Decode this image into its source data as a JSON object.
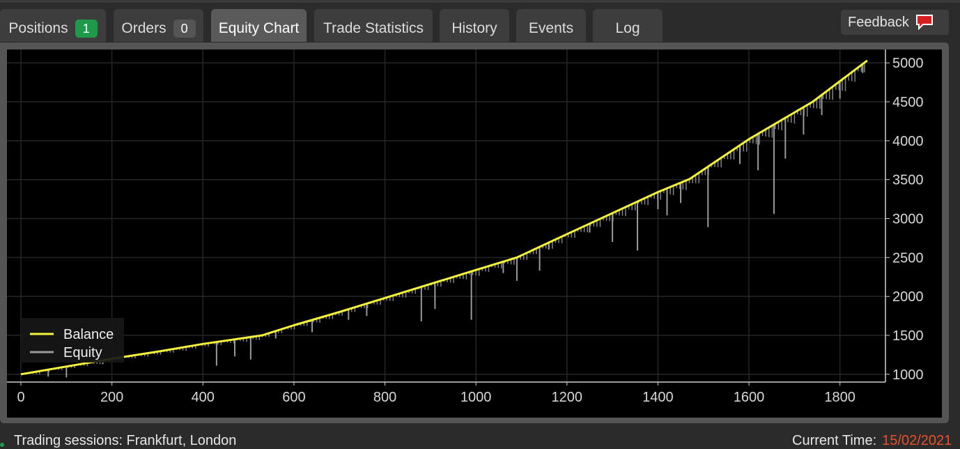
{
  "tabs": [
    {
      "label": "Positions",
      "badge": "1",
      "badge_color": "#1f9a4a"
    },
    {
      "label": "Orders",
      "badge": "0"
    },
    {
      "label": "Equity Chart",
      "active": true
    },
    {
      "label": "Trade Statistics"
    },
    {
      "label": "History"
    },
    {
      "label": "Events"
    },
    {
      "label": "Log"
    }
  ],
  "feedback": {
    "label": "Feedback",
    "icon": "speech-bubble-icon"
  },
  "status": {
    "sessions": "Trading sessions: Frankfurt, London",
    "current_time_label": "Current Time:",
    "current_time_value": "15/02/2021"
  },
  "colors": {
    "balance": "#f5f53a",
    "equity": "#9a9a9a",
    "accent_time": "#e8502a"
  },
  "chart_data": {
    "type": "line",
    "xlim": [
      0,
      1900
    ],
    "ylim": [
      900,
      5100
    ],
    "x_ticks": [
      0,
      200,
      400,
      600,
      800,
      1000,
      1200,
      1400,
      1600,
      1800
    ],
    "y_ticks": [
      1000,
      1500,
      2000,
      2500,
      3000,
      3500,
      4000,
      4500,
      5000
    ],
    "legend": {
      "position": "bottom-left",
      "entries": [
        "Balance",
        "Equity"
      ]
    },
    "grid": true,
    "series": [
      {
        "name": "Balance",
        "x": [
          0,
          100,
          200,
          300,
          400,
          530,
          600,
          700,
          800,
          900,
          1000,
          1090,
          1200,
          1300,
          1400,
          1470,
          1600,
          1740,
          1860
        ],
        "y": [
          1000,
          1100,
          1200,
          1290,
          1390,
          1500,
          1630,
          1800,
          1980,
          2160,
          2340,
          2500,
          2800,
          3070,
          3340,
          3510,
          4020,
          4500,
          5030
        ]
      },
      {
        "name": "Equity",
        "drawdowns": [
          [
            60,
            970
          ],
          [
            100,
            960
          ],
          [
            180,
            1130
          ],
          [
            430,
            1110
          ],
          [
            470,
            1230
          ],
          [
            505,
            1190
          ],
          [
            560,
            1460
          ],
          [
            640,
            1540
          ],
          [
            720,
            1700
          ],
          [
            760,
            1750
          ],
          [
            880,
            1680
          ],
          [
            910,
            1840
          ],
          [
            990,
            1700
          ],
          [
            1060,
            2300
          ],
          [
            1090,
            2200
          ],
          [
            1140,
            2330
          ],
          [
            1160,
            2600
          ],
          [
            1250,
            2820
          ],
          [
            1300,
            2700
          ],
          [
            1355,
            2590
          ],
          [
            1400,
            3120
          ],
          [
            1420,
            3040
          ],
          [
            1450,
            3200
          ],
          [
            1510,
            2890
          ],
          [
            1580,
            3700
          ],
          [
            1620,
            3620
          ],
          [
            1655,
            3060
          ],
          [
            1680,
            3770
          ],
          [
            1720,
            4080
          ],
          [
            1760,
            4330
          ],
          [
            1800,
            4540
          ],
          [
            1850,
            4870
          ]
        ]
      }
    ]
  }
}
